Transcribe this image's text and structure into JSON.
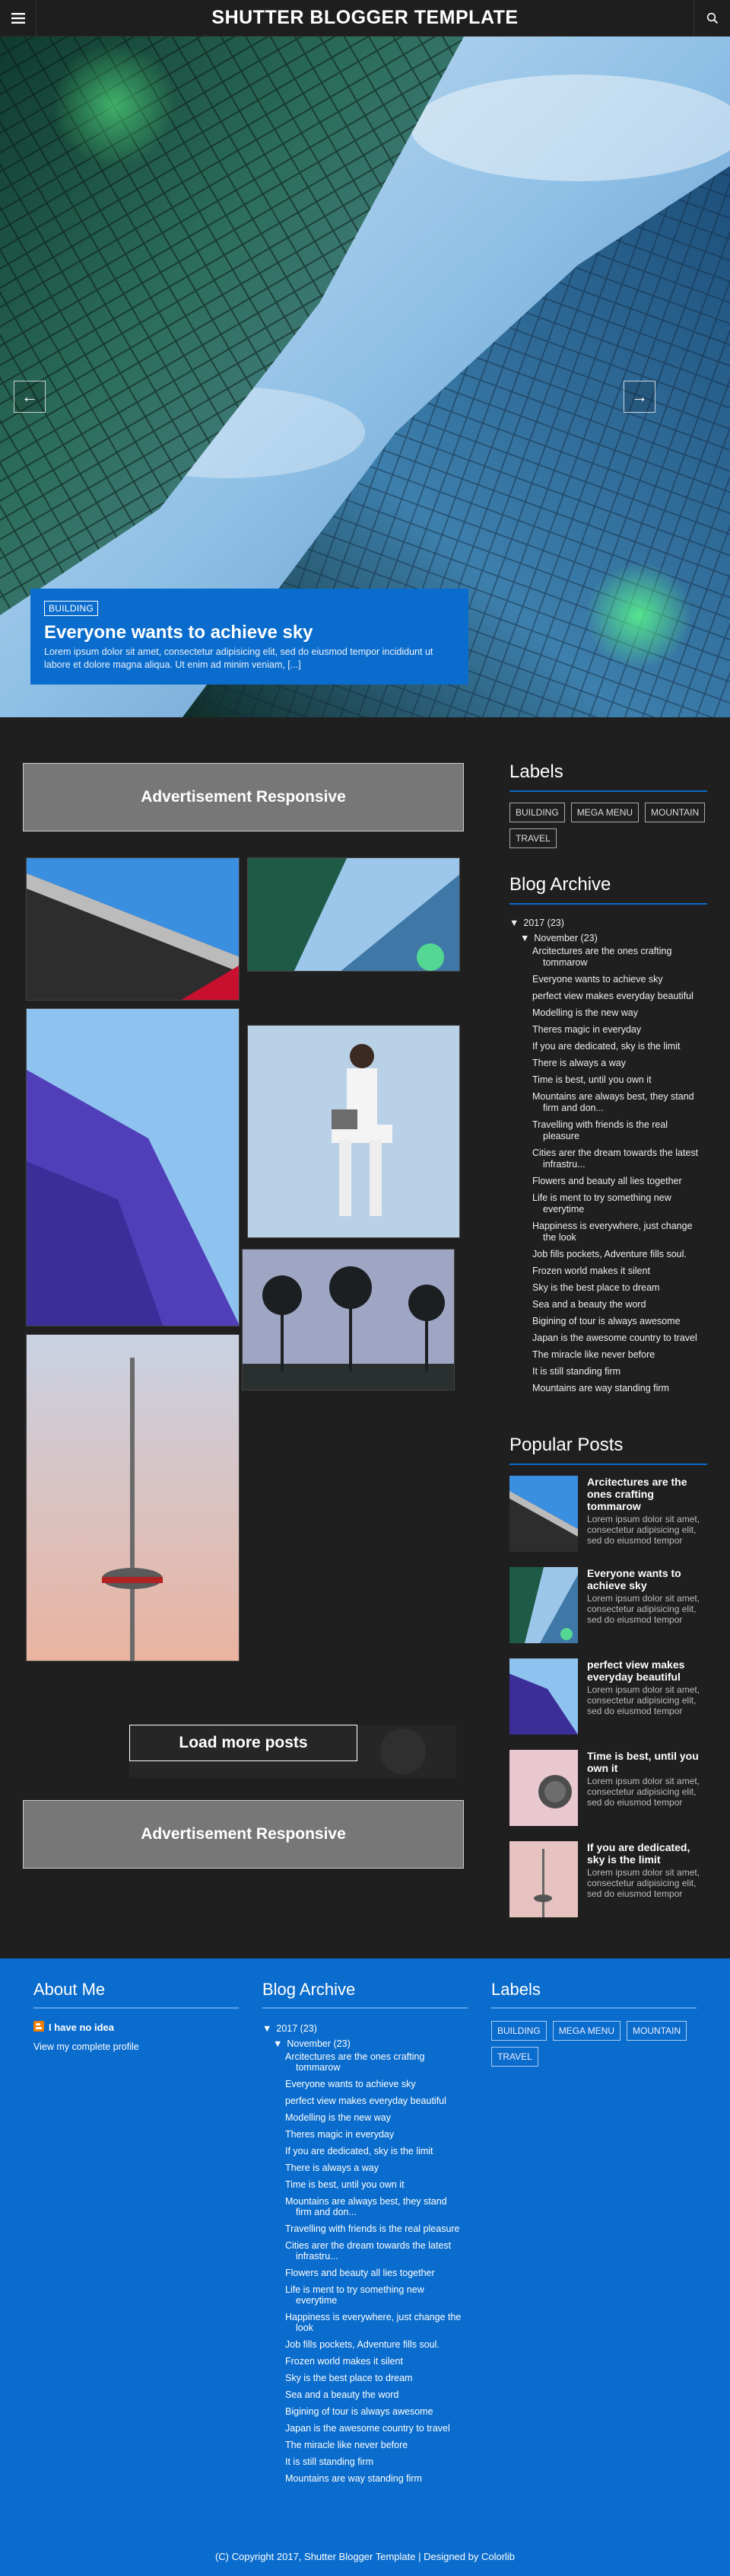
{
  "header": {
    "title": "SHUTTER BLOGGER TEMPLATE",
    "menu_icon": "hamburger-icon",
    "search_icon": "search-icon"
  },
  "slider": {
    "tag": "BUILDING",
    "title": "Everyone wants to achieve sky",
    "excerpt": "Lorem ipsum dolor sit amet, consectetur adipisicing elit, sed do eiusmod tempor incididunt ut labore et dolore magna aliqua. Ut enim ad minim veniam, [...]",
    "prev_icon": "arrow-left-icon",
    "next_icon": "arrow-right-icon"
  },
  "ads": {
    "top": "Advertisement Responsive",
    "bottom": "Advertisement Responsive"
  },
  "load_more": "Load more posts",
  "sidebar": {
    "labels_title": "Labels",
    "labels": [
      "BUILDING",
      "MEGA MENU",
      "MOUNTAIN",
      "TRAVEL"
    ],
    "archive_title": "Blog Archive",
    "archive_year": "2017 (23)",
    "archive_month": "November (23)",
    "archive_posts": [
      "Arcitectures are the ones crafting tommarow",
      "Everyone wants to achieve sky",
      "perfect view makes everyday beautiful",
      "Modelling is the new way",
      "Theres magic in everyday",
      "If you are dedicated, sky is the limit",
      "There is always a way",
      "Time is best, until you own it",
      "Mountains are always best, they stand firm and don...",
      "Travelling with friends is the real pleasure",
      "Cities arer the dream towards the latest infrastru...",
      "Flowers and beauty all lies together",
      "Life is ment to try something new everytime",
      "Happiness is everywhere, just change the look",
      "Job fills pockets, Adventure fills soul.",
      "Frozen world makes it silent",
      "Sky is the best place to dream",
      "Sea and a beauty the word",
      "Bigining of tour is always awesome",
      "Japan is the awesome country to travel",
      "The miracle like never before",
      "It is still standing firm",
      "Mountains are way standing firm"
    ],
    "popular_title": "Popular Posts",
    "popular": [
      {
        "title": "Arcitectures are the ones crafting tommarow",
        "desc": "Lorem ipsum dolor sit amet, consectetur adipisicing elit, sed do eiusmod tempor"
      },
      {
        "title": "Everyone wants to achieve sky",
        "desc": "Lorem ipsum dolor sit amet, consectetur adipisicing elit, sed do eiusmod tempor"
      },
      {
        "title": "perfect view makes everyday beautiful",
        "desc": "Lorem ipsum dolor sit amet, consectetur adipisicing elit, sed do eiusmod tempor"
      },
      {
        "title": "Time is best, until you own it",
        "desc": "Lorem ipsum dolor sit amet, consectetur adipisicing elit, sed do eiusmod tempor"
      },
      {
        "title": "If you are dedicated, sky is the limit",
        "desc": "Lorem ipsum dolor sit amet, consectetur adipisicing elit, sed do eiusmod tempor"
      }
    ]
  },
  "footer": {
    "about_title": "About Me",
    "about_name": "I have no idea",
    "about_link": "View my complete profile",
    "archive_title": "Blog Archive",
    "labels_title": "Labels",
    "copyright": "(C) Copyright 2017, Shutter Blogger Template | Designed by Colorlib"
  },
  "colors": {
    "accent": "#0a6ccc",
    "background": "#1f1f1f",
    "ad_box": "#777777"
  }
}
